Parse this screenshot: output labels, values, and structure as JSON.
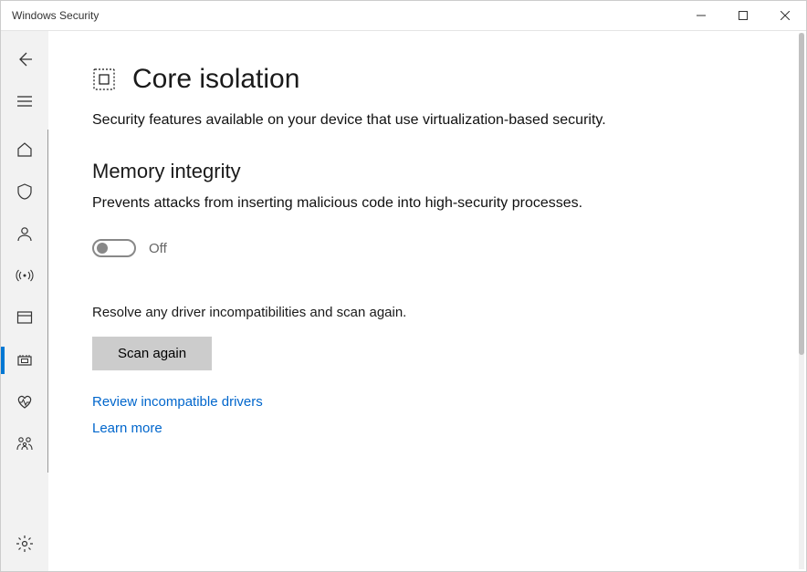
{
  "titlebar": {
    "title": "Windows Security"
  },
  "page": {
    "title": "Core isolation",
    "description": "Security features available on your device that use virtualization-based security.",
    "section_title": "Memory integrity",
    "section_description": "Prevents attacks from inserting malicious code into high-security processes.",
    "toggle_state_label": "Off",
    "resolve_text": "Resolve any driver incompatibilities and scan again.",
    "scan_button": "Scan again",
    "review_link": "Review incompatible drivers",
    "learn_more_link": "Learn more"
  }
}
